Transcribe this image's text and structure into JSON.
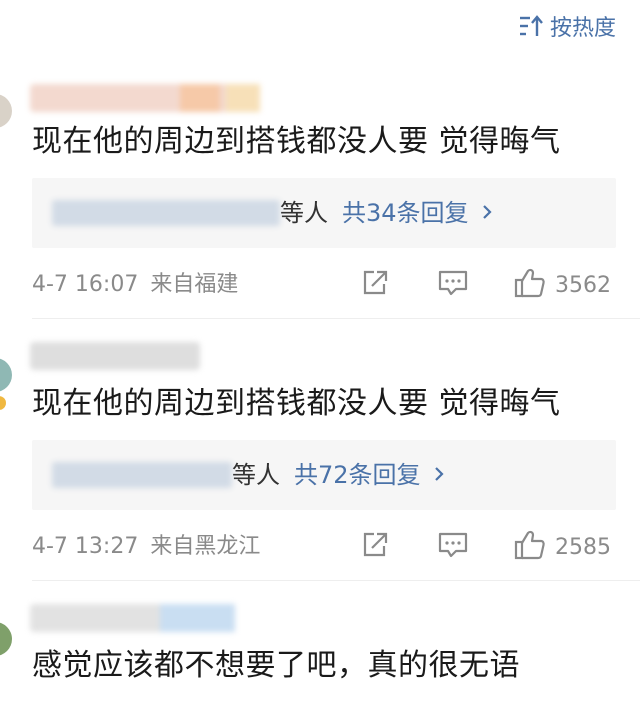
{
  "sort": {
    "label": "按热度",
    "icon": "sort-icon"
  },
  "comments": [
    {
      "text": "现在他的周边到搭钱都没人要 觉得晦气",
      "reply_visible_tail": "等人",
      "reply_count_label": "共34条回复",
      "time": "4-7 16:07",
      "location": "来自福建",
      "likes": "3562",
      "icons": [
        "share-icon",
        "comment-icon",
        "like-icon"
      ]
    },
    {
      "text": "现在他的周边到搭钱都没人要 觉得晦气",
      "reply_visible_tail": "等人",
      "reply_count_label": "共72条回复",
      "time": "4-7 13:27",
      "location": "来自黑龙江",
      "likes": "2585",
      "icons": [
        "share-icon",
        "comment-icon",
        "like-icon"
      ]
    },
    {
      "text": "感觉应该都不想要了吧，真的很无语"
    }
  ],
  "colors": {
    "link": "#4a72a8",
    "meta": "#8a8a8a",
    "reply_bg": "#f6f6f6"
  }
}
